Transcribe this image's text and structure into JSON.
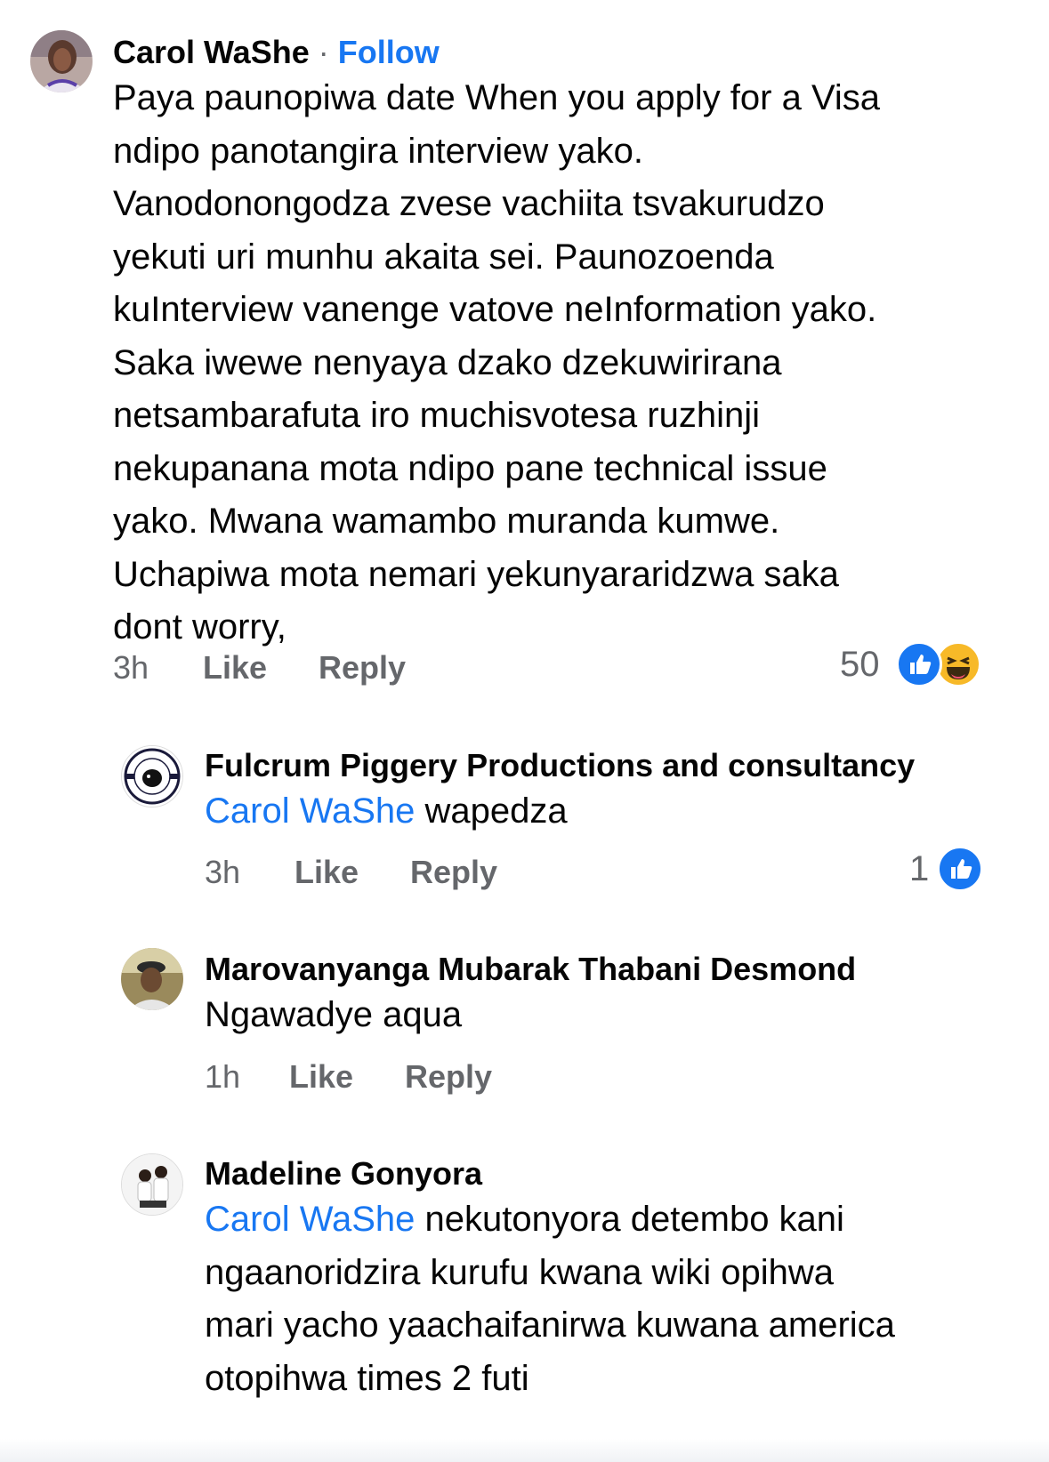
{
  "comment1": {
    "author": "Carol WaShe",
    "separator": "·",
    "follow": "Follow",
    "lines": [
      "Paya paunopiwa date When you apply for a Visa",
      "ndipo panotangira interview yako.",
      "Vanodonongodza zvese vachiita tsvakurudzo",
      "yekuti uri munhu akaita sei. Paunozoenda",
      "kuInterview vanenge vatove neInformation yako.",
      "Saka iwewe nenyaya dzako dzekuwirirana",
      "netsambarafuta iro muchisvotesa ruzhinji",
      "nekupanana mota ndipo pane technical issue",
      "yako. Mwana wamambo muranda kumwe.",
      "Uchapiwa mota nemari yekunyararidzwa saka",
      "dont worry,"
    ],
    "time": "3h",
    "like": "Like",
    "reply": "Reply",
    "reaction_count": "50",
    "reactions": [
      "like-icon",
      "haha-icon"
    ]
  },
  "reply1": {
    "author": "Fulcrum Piggery Productions and consultancy",
    "mention": "Carol WaShe",
    "text": " wapedza",
    "time": "3h",
    "like": "Like",
    "reply": "Reply",
    "reaction_count": "1"
  },
  "reply2": {
    "author": "Marovanyanga Mubarak Thabani Desmond",
    "text": "Ngawadye aqua",
    "time": "1h",
    "like": "Like",
    "reply": "Reply"
  },
  "reply3": {
    "author": "Madeline Gonyora",
    "mention": "Carol WaShe",
    "line1": " nekutonyora detembo kani",
    "lines": [
      "ngaanoridzira kurufu kwana wiki opihwa",
      "mari yacho yaachaifanirwa kuwana america",
      "otopihwa times 2 futi"
    ]
  },
  "colors": {
    "accent": "#1877f2",
    "secondary_text": "#65676b",
    "primary_text": "#050505"
  }
}
